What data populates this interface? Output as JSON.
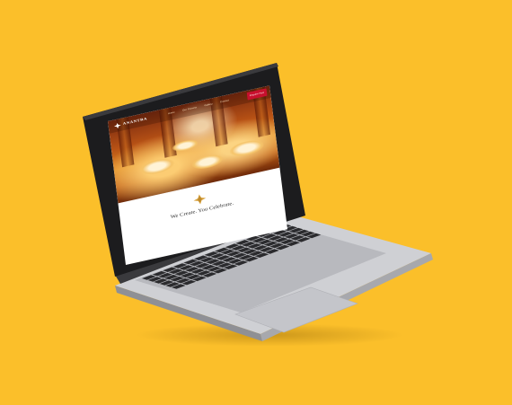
{
  "colors": {
    "background": "#fbbf2a",
    "accent_red": "#c8102e",
    "logo_star": "#d9a441"
  },
  "laptop": {
    "site": {
      "logo": {
        "icon": "star-logo-icon",
        "text": "ANANTRA"
      },
      "nav_links": [
        "Home",
        "Our Process",
        "Gallery",
        "Contact"
      ],
      "cta_label": "Enquire Now",
      "hero_image": "banquet-hall-photo",
      "tagline_icon": "star-logo-icon",
      "tagline": "We Create. You Celebrate."
    }
  }
}
